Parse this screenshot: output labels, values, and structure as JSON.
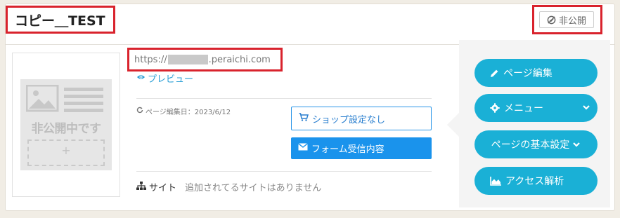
{
  "header": {
    "title": "コピー＿TEST",
    "status_label": "非公開"
  },
  "thumbnail": {
    "placeholder_text": "非公開中です",
    "plus": "+"
  },
  "url": {
    "prefix": "https://",
    "suffix": ".peraichi.com"
  },
  "preview": {
    "label": "プレビュー"
  },
  "meta": {
    "edit_date": "ページ編集日：2023/6/12"
  },
  "buttons": {
    "shop": "ショップ設定なし",
    "form": "フォーム受信内容"
  },
  "site": {
    "label": "サイト",
    "empty_text": "追加されてるサイトはありません"
  },
  "actions": {
    "edit": "ページ編集",
    "menu": "メニュー",
    "basic_settings": "ページの基本設定",
    "analytics": "アクセス解析"
  },
  "colors": {
    "accent": "#1ab0d6",
    "primary_blue": "#1a93ec",
    "highlight_red": "#d9232d"
  }
}
